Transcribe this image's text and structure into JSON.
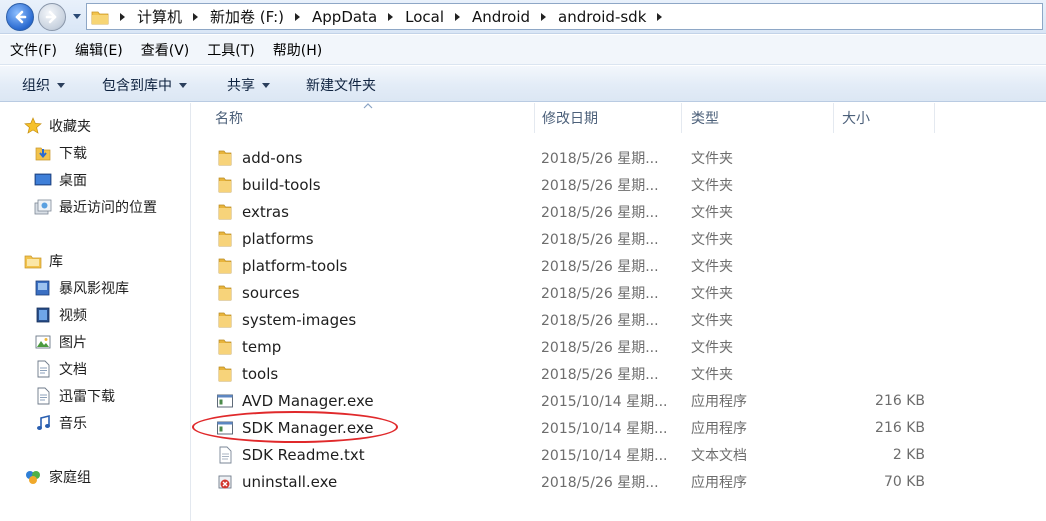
{
  "address_bar": {
    "crumbs": [
      "计算机",
      "新加卷 (F:)",
      "AppData",
      "Local",
      "Android",
      "android-sdk"
    ]
  },
  "menu": {
    "items": [
      "文件(F)",
      "编辑(E)",
      "查看(V)",
      "工具(T)",
      "帮助(H)"
    ]
  },
  "toolbar": {
    "organize": "组织",
    "include_in_library": "包含到库中",
    "share": "共享",
    "new_folder": "新建文件夹"
  },
  "nav_pane": {
    "favorites": {
      "label": "收藏夹",
      "items": [
        "下载",
        "桌面",
        "最近访问的位置"
      ]
    },
    "libraries": {
      "label": "库",
      "items": [
        "暴风影视库",
        "视频",
        "图片",
        "文档",
        "迅雷下载",
        "音乐"
      ]
    },
    "homegroup": {
      "label": "家庭组"
    }
  },
  "file_list": {
    "columns": {
      "name": "名称",
      "date": "修改日期",
      "type": "类型",
      "size": "大小"
    },
    "rows": [
      {
        "name": "add-ons",
        "date": "2018/5/26 星期...",
        "type": "文件夹",
        "size": "",
        "icon": "folder-icon"
      },
      {
        "name": "build-tools",
        "date": "2018/5/26 星期...",
        "type": "文件夹",
        "size": "",
        "icon": "folder-icon"
      },
      {
        "name": "extras",
        "date": "2018/5/26 星期...",
        "type": "文件夹",
        "size": "",
        "icon": "folder-icon"
      },
      {
        "name": "platforms",
        "date": "2018/5/26 星期...",
        "type": "文件夹",
        "size": "",
        "icon": "folder-icon"
      },
      {
        "name": "platform-tools",
        "date": "2018/5/26 星期...",
        "type": "文件夹",
        "size": "",
        "icon": "folder-icon"
      },
      {
        "name": "sources",
        "date": "2018/5/26 星期...",
        "type": "文件夹",
        "size": "",
        "icon": "folder-icon"
      },
      {
        "name": "system-images",
        "date": "2018/5/26 星期...",
        "type": "文件夹",
        "size": "",
        "icon": "folder-icon"
      },
      {
        "name": "temp",
        "date": "2018/5/26 星期...",
        "type": "文件夹",
        "size": "",
        "icon": "folder-icon"
      },
      {
        "name": "tools",
        "date": "2018/5/26 星期...",
        "type": "文件夹",
        "size": "",
        "icon": "folder-icon"
      },
      {
        "name": "AVD Manager.exe",
        "date": "2015/10/14 星期...",
        "type": "应用程序",
        "size": "216 KB",
        "icon": "exe-icon"
      },
      {
        "name": "SDK Manager.exe",
        "date": "2015/10/14 星期...",
        "type": "应用程序",
        "size": "216 KB",
        "icon": "exe-icon"
      },
      {
        "name": "SDK Readme.txt",
        "date": "2015/10/14 星期...",
        "type": "文本文档",
        "size": "2 KB",
        "icon": "text-file-icon"
      },
      {
        "name": "uninstall.exe",
        "date": "2018/5/26 星期...",
        "type": "应用程序",
        "size": "70 KB",
        "icon": "uninstall-icon"
      }
    ]
  },
  "colors": {
    "highlight_ellipse": "#e0292b",
    "folder": "#f2c34c"
  }
}
